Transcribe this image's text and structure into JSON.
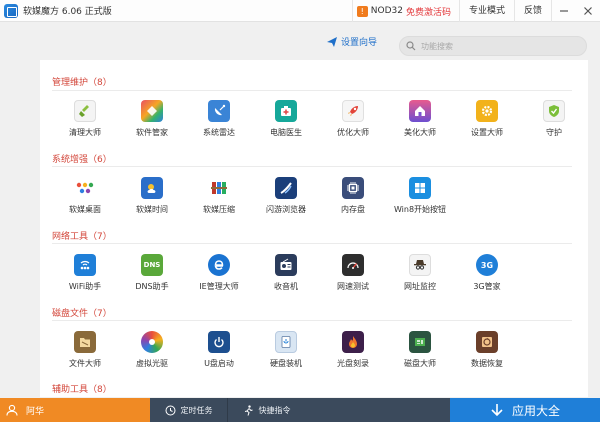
{
  "titlebar": {
    "app_title": "软媒魔方 6.06 正式版",
    "promo_brand": "NOD32",
    "promo_text": "免费激活码",
    "pro_mode": "专业模式",
    "feedback": "反馈"
  },
  "toolbar": {
    "wizard_label": "设置向导",
    "search_placeholder": "功能搜索"
  },
  "sections": [
    {
      "title": "管理维护（8）",
      "items": [
        "清理大师",
        "软件管家",
        "系统雷达",
        "电脑医生",
        "优化大师",
        "美化大师",
        "设置大师",
        "守护"
      ]
    },
    {
      "title": "系统增强（6）",
      "items": [
        "软媒桌面",
        "软媒时间",
        "软媒压缩",
        "闪游浏览器",
        "内存盘",
        "Win8开始按钮"
      ]
    },
    {
      "title": "网络工具（7）",
      "items": [
        "WiFi助手",
        "DNS助手",
        "IE管理大师",
        "收音机",
        "网速测试",
        "网址监控",
        "3G管家"
      ]
    },
    {
      "title": "磁盘文件（7）",
      "items": [
        "文件大师",
        "虚拟光驱",
        "U盘启动",
        "硬盘装机",
        "光盘刻录",
        "磁盘大师",
        "数据恢复"
      ]
    },
    {
      "title": "辅助工具（8）",
      "items": []
    }
  ],
  "icon_text": {
    "dns": "DNS",
    "3g": "3G"
  },
  "bottombar": {
    "user_name": "阿华",
    "timer_task": "定时任务",
    "quick_cmd": "快捷指令",
    "app_all": "应用大全"
  },
  "colors": {
    "accent_blue": "#1f7fd8",
    "user_orange": "#f08a24",
    "section_red": "#d3463a",
    "bottom_dark": "#3b4a5c"
  }
}
